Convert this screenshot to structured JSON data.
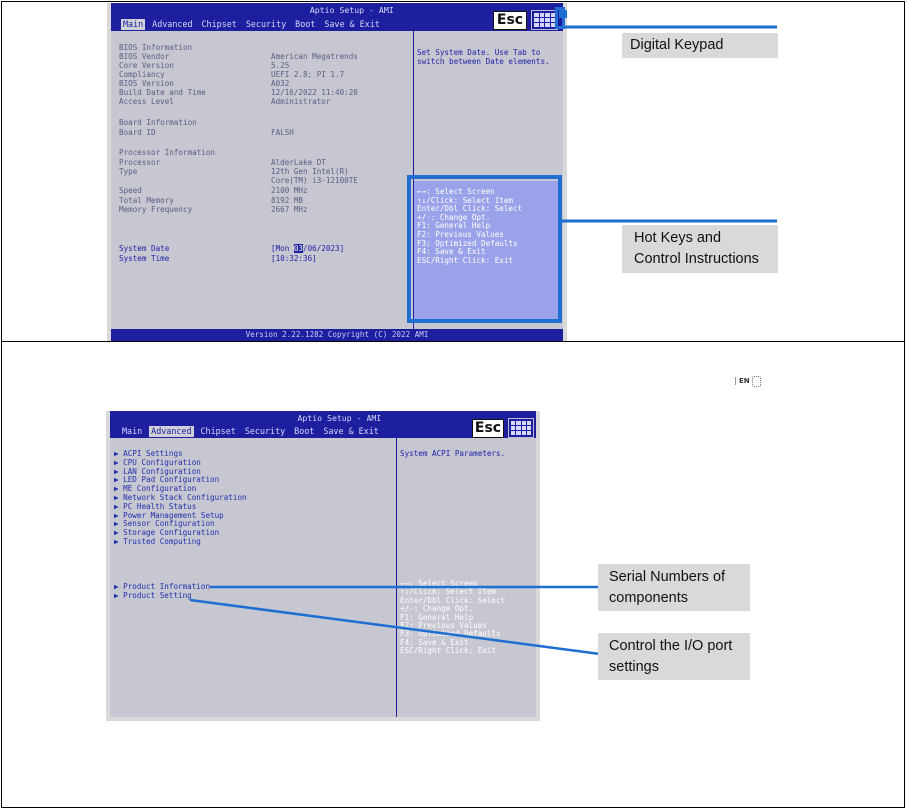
{
  "page_annotations": {
    "digital_keypad": "Digital Keypad",
    "hotkeys_line1": "Hot Keys and",
    "hotkeys_line2": "Control Instructions",
    "serial_line1": "Serial Numbers of",
    "serial_line2": "components",
    "io_line1": "Control the I/O port",
    "io_line2": "settings",
    "lang_badge": "EN"
  },
  "bios_common": {
    "title": "Aptio Setup - AMI",
    "esc": "Esc",
    "tabs": [
      "Main",
      "Advanced",
      "Chipset",
      "Security",
      "Boot",
      "Save & Exit"
    ],
    "footer": "Version 2.22.1282 Copyright (C) 2022 AMI"
  },
  "screen1": {
    "active_tab": "Main",
    "rows": [
      {
        "label": "BIOS Information",
        "value": ""
      },
      {
        "label": "BIOS Vendor",
        "value": "American Megatrends"
      },
      {
        "label": "Core Version",
        "value": "5.25"
      },
      {
        "label": "Compliancy",
        "value": "UEFI 2.8; PI 1.7"
      },
      {
        "label": "BIOS Version",
        "value": "A032"
      },
      {
        "label": "Build Date and Time",
        "value": "12/16/2022 11:40:20"
      },
      {
        "label": "Access Level",
        "value": "Administrator"
      },
      {
        "label": "Board Information",
        "value": ""
      },
      {
        "label": "Board ID",
        "value": "FALSH"
      },
      {
        "label": "Processor Information",
        "value": ""
      },
      {
        "label": "Processor",
        "value": "AlderLake DT"
      },
      {
        "label": "Type",
        "value": "12th Gen Intel(R)"
      },
      {
        "label": "",
        "value": "Core(TM) i3-12100TE"
      },
      {
        "label": "Speed",
        "value": "2100 MHz"
      },
      {
        "label": "Total Memory",
        "value": "8192 MB"
      },
      {
        "label": "Memory Frequency",
        "value": " 2667 MHz"
      },
      {
        "label": "System Date",
        "value": "[Mon 03/06/2023]"
      },
      {
        "label": "System Time",
        "value": "[10:32:36]"
      }
    ],
    "date_prefix": "[Mon ",
    "date_month": "03",
    "date_suffix": "/06/2023]",
    "help_line1": "Set System Date. Use Tab to",
    "help_line2": "switch between Date elements.",
    "hotkeys": [
      "←→: Select Screen",
      "↑↓/Click: Select Item",
      "Enter/Dbl Click: Select",
      "+/-: Change Opt.",
      "F1: General Help",
      "F2: Previous Values",
      "F3: Optimized Defaults",
      "F4: Save & Exit",
      "ESC/Right Click: Exit"
    ]
  },
  "screen2": {
    "active_tab": "Advanced",
    "menu": [
      "ACPI Settings",
      "CPU Configuration",
      "LAN Configuration",
      "LED Pad Configuration",
      "ME Configuration",
      "Network Stack Configuration",
      "PC Health Status",
      "Power Management Setup",
      "Sensor Configuration",
      "Storage Configuration",
      "Trusted Computing"
    ],
    "menu2": [
      "Product Information",
      "Product Setting"
    ],
    "help_line1": "System ACPI Parameters.",
    "hotkeys": [
      "←→: Select Screen",
      "↑↓/Click: Select Item",
      "Enter/Dbl Click: Select",
      "+/-: Change Opt.",
      "F1: General Help",
      "F2: Previous Values",
      "F3: Optimized Defaults",
      "F4: Save & Exit",
      "ESC/Right Click: Exit"
    ]
  },
  "colors": {
    "bios_blue": "#1d1f9e",
    "callout_blue": "#1e6fd1",
    "label_bg": "#d9d9d9"
  }
}
